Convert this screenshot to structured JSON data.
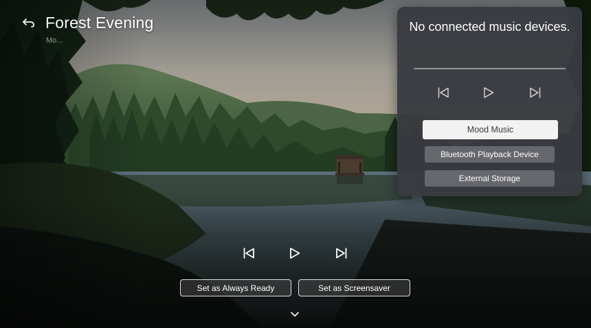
{
  "header": {
    "title": "Forest Evening",
    "subtitle": "Mo..."
  },
  "controls": {
    "always_ready_label": "Set as Always Ready",
    "screensaver_label": "Set as Screensaver"
  },
  "music_panel": {
    "message": "No connected music devices.",
    "options": [
      "Mood Music",
      "Bluetooth Playback Device",
      "External Storage"
    ],
    "selected_option": "Mood Music"
  },
  "icons": {
    "back": "back-arrow-icon",
    "previous": "skip-previous-icon",
    "play": "play-icon",
    "next": "skip-next-icon",
    "scroll_down": "chevron-down-icon"
  },
  "colors": {
    "panel_background": "#383a40",
    "selected_option_background": "#f2f2f2",
    "option_background": "#6e7076"
  }
}
